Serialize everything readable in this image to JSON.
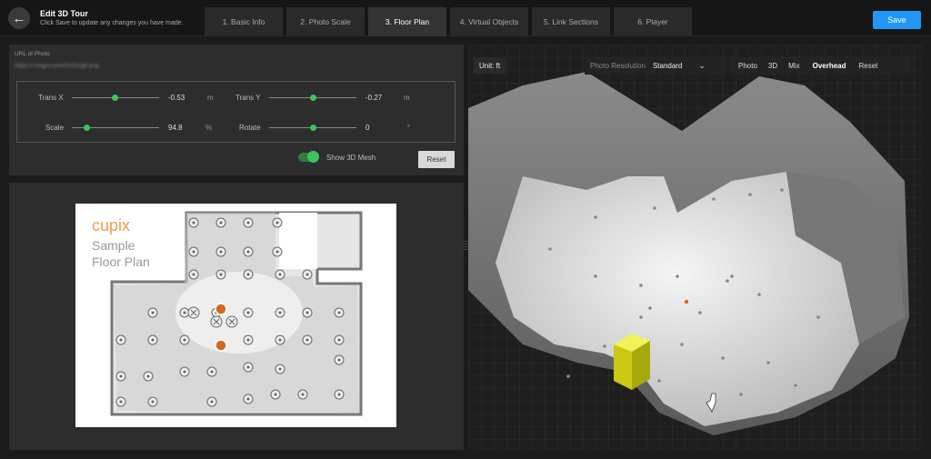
{
  "header": {
    "title": "Edit 3D Tour",
    "subtitle": "Click Save to update any changes you have made.",
    "tabs": [
      {
        "label": "1. Basic Info",
        "active": false
      },
      {
        "label": "2. Photo Scale",
        "active": false
      },
      {
        "label": "3. Floor Plan",
        "active": true
      },
      {
        "label": "4. Virtual Objects",
        "active": false
      },
      {
        "label": "5. Link Sections",
        "active": false
      },
      {
        "label": "6. Player",
        "active": false
      }
    ],
    "save_label": "Save"
  },
  "settings": {
    "url_label": "URL of Photo",
    "url_value": "https://i.imgur.com/GUGzg8.png",
    "trans_x": {
      "label": "Trans X",
      "value": "-0.53",
      "unit": "m"
    },
    "trans_y": {
      "label": "Trans Y",
      "value": "-0.27",
      "unit": "m"
    },
    "scale": {
      "label": "Scale",
      "value": "94.8",
      "unit": "%"
    },
    "rotate": {
      "label": "Rotate",
      "value": "0",
      "unit": "°"
    },
    "show_mesh_label": "Show 3D Mesh",
    "show_mesh_on": true,
    "reset_label": "Reset"
  },
  "floorplan": {
    "brand": "cupix",
    "title_line1": "Sample",
    "title_line2": "Floor Plan"
  },
  "viewer": {
    "unit_label": "Unit: ft",
    "resolution_label": "Photo Resolution",
    "resolution_value": "Standard",
    "modes": [
      "Photo",
      "3D",
      "Mix",
      "Overhead"
    ],
    "active_mode": "Overhead",
    "reset_label": "Reset"
  },
  "colors": {
    "accent": "#2196f3",
    "toggle_green": "#3cc45b",
    "brand_orange": "#f39c4a",
    "marker_orange": "#d2691e",
    "object_yellow": "#e6e61e"
  }
}
